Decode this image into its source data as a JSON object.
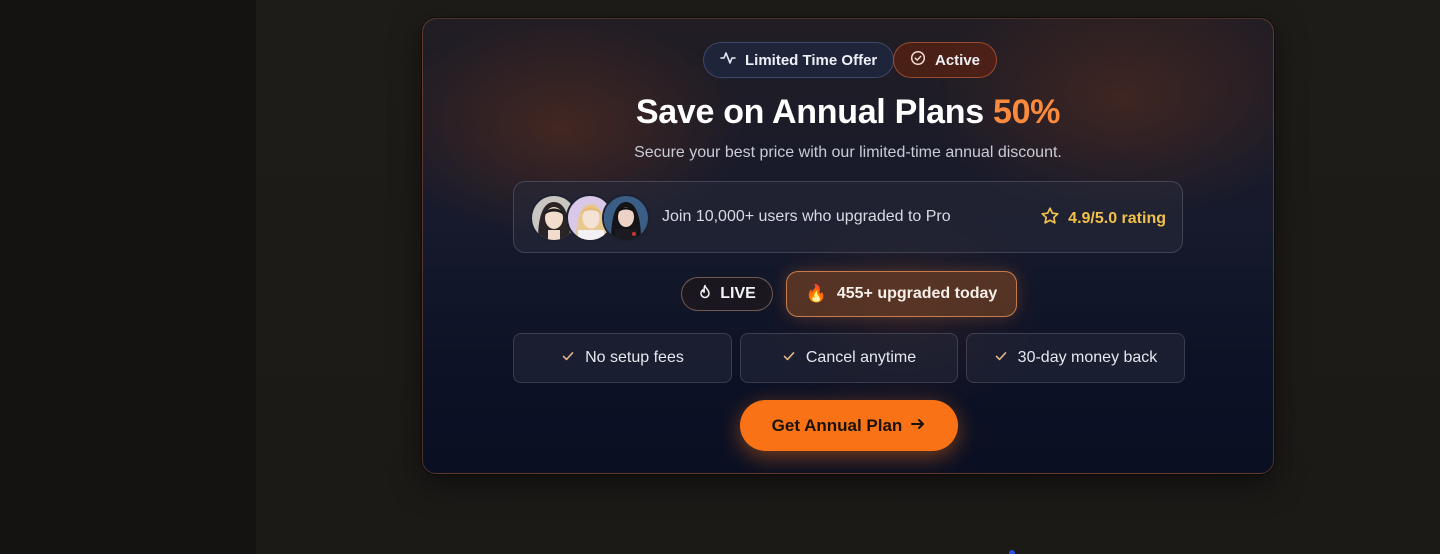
{
  "badges": {
    "offer_label": "Limited Time Offer",
    "offer_icon": "activity-icon",
    "active_label": "Active",
    "active_icon": "check-circle-icon"
  },
  "hero": {
    "title": "Save on Annual Plans",
    "accent": "50%",
    "subtitle": "Secure your best price with our limited-time annual discount."
  },
  "social_proof": {
    "text": "Join 10,000+ users who upgraded to Pro",
    "rating": "4.9/5.0 rating",
    "rating_icon": "star-icon",
    "avatars": [
      "avatar-user-1",
      "avatar-user-2",
      "avatar-user-3"
    ]
  },
  "live": {
    "label": "LIVE",
    "icon": "flame-icon",
    "upgrade_emoji": "🔥",
    "upgrade_text": "455+ upgraded today"
  },
  "features": [
    {
      "label": "No setup fees"
    },
    {
      "label": "Cancel anytime"
    },
    {
      "label": "30-day money back"
    }
  ],
  "cta": {
    "label": "Get Annual Plan",
    "icon": "arrow-right-icon"
  },
  "colors": {
    "accent": "#fb8a3c",
    "cta": "#f97316",
    "rating": "#f2c14a"
  }
}
